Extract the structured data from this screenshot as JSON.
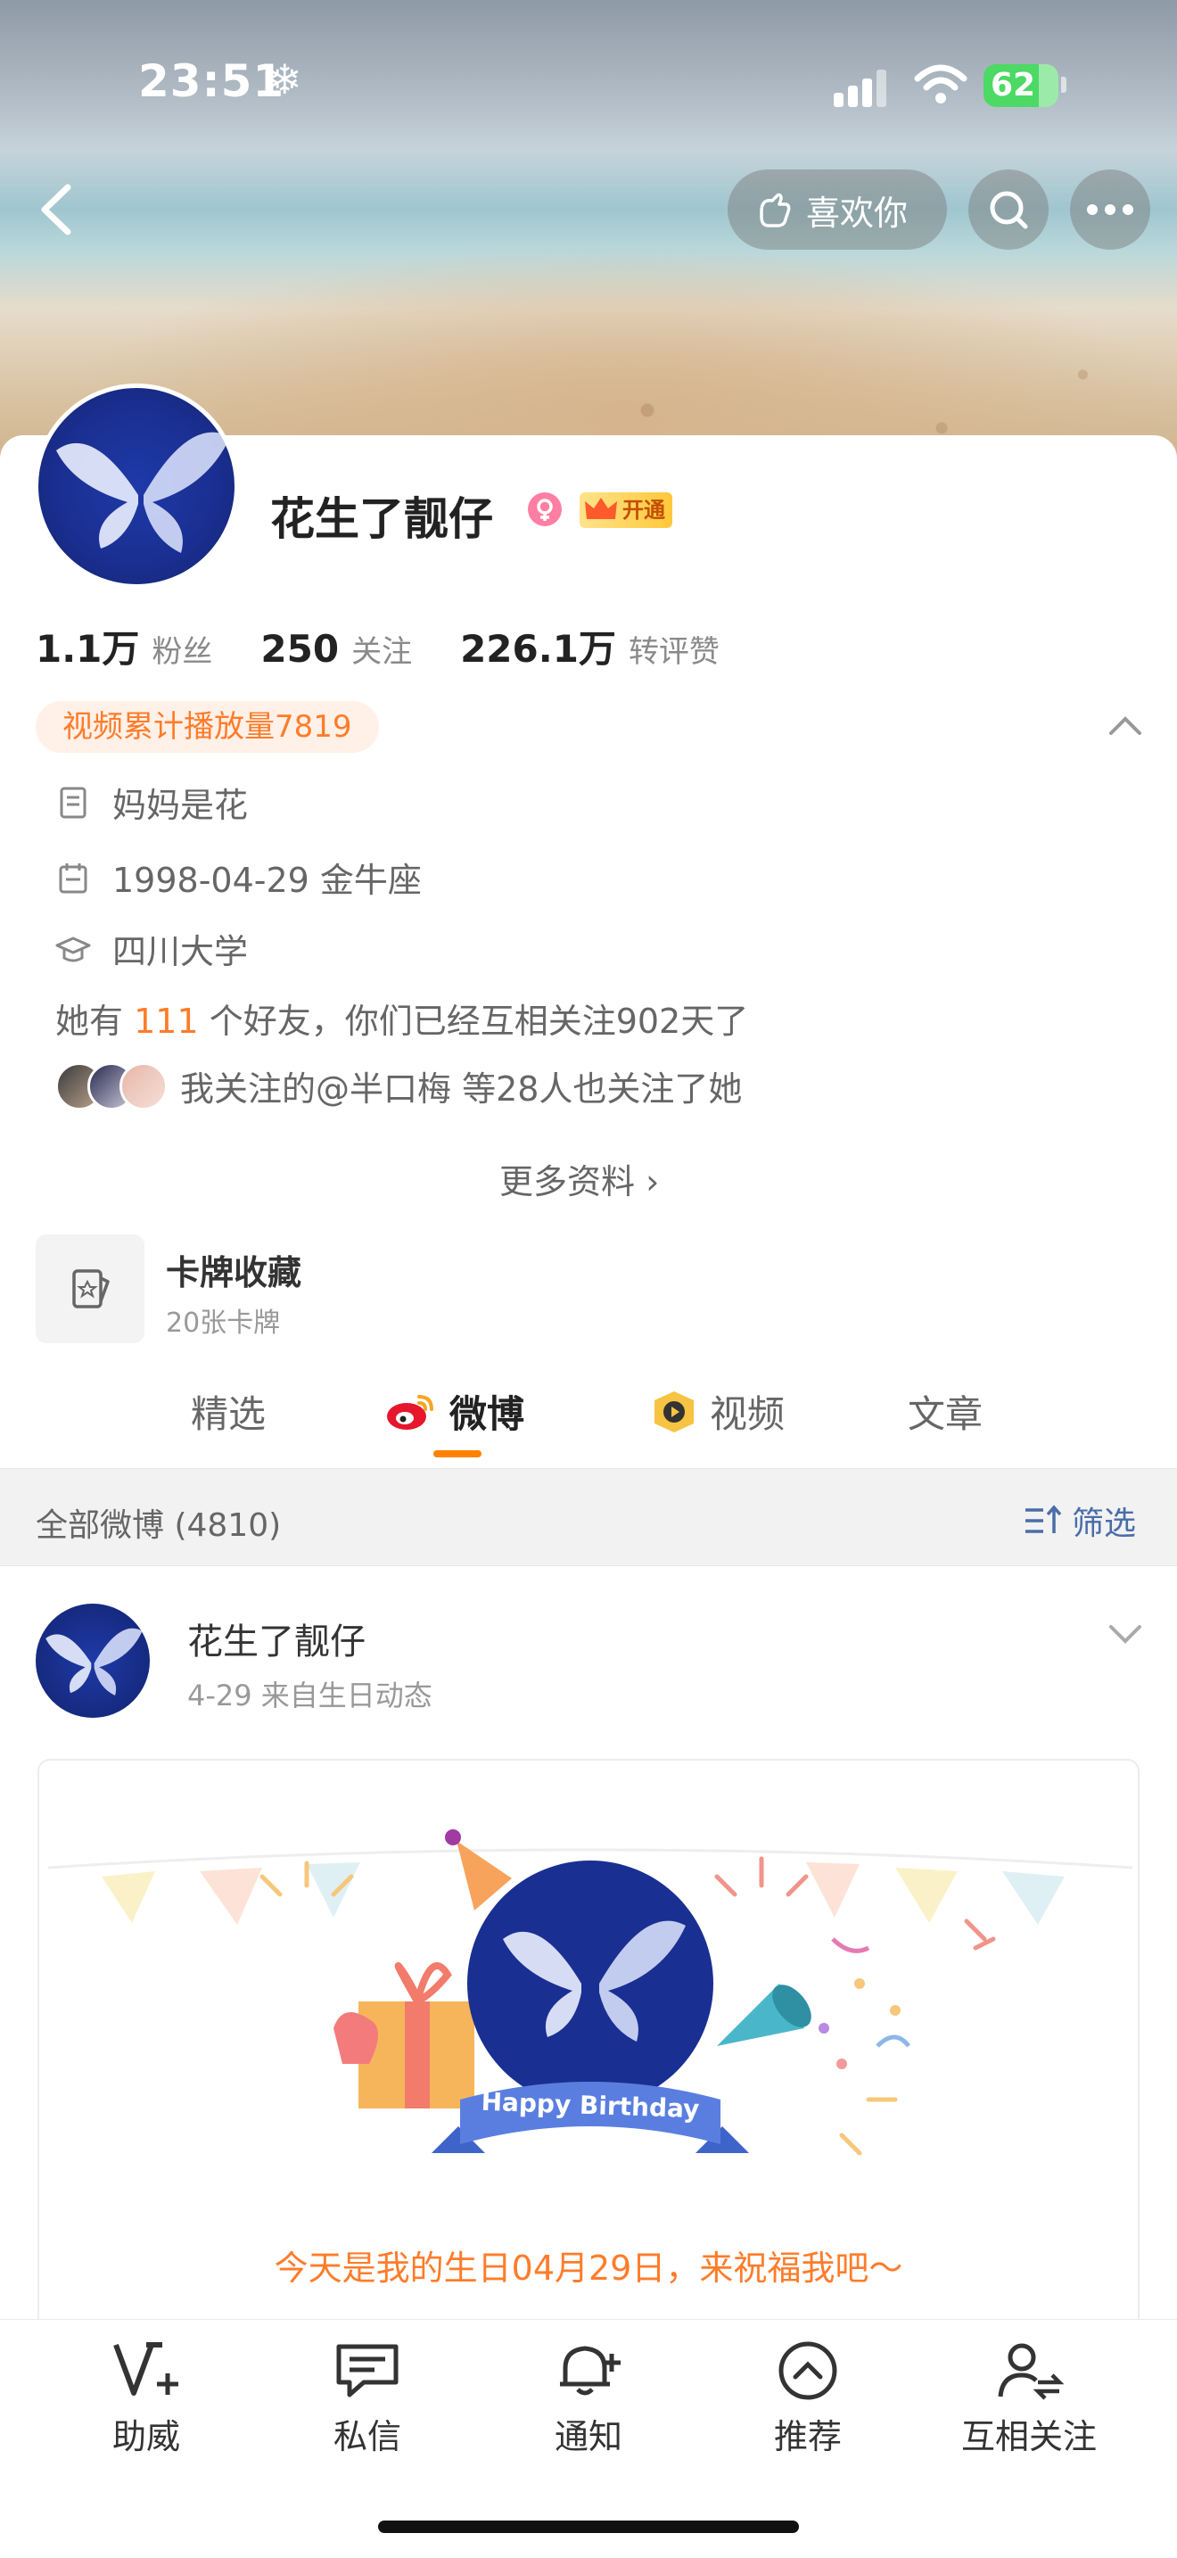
{
  "status_bar": {
    "time": "23:51",
    "battery": "62"
  },
  "header": {
    "like_label": "喜欢你"
  },
  "profile": {
    "nickname": "花生了靓仔",
    "vip_label": "开通",
    "stats": [
      {
        "value": "1.1万",
        "label": "粉丝"
      },
      {
        "value": "250",
        "label": "关注"
      },
      {
        "value": "226.1万",
        "label": "转评赞"
      }
    ],
    "video_tag": "视频累计播放量7819",
    "bio": "妈妈是花",
    "birthday": "1998-04-29 金牛座",
    "school": "四川大学",
    "friends": {
      "prefix": "她有 ",
      "count": "111",
      "suffix": " 个好友，你们已经互相关注902天了"
    },
    "mutual": "我关注的@半口梅 等28人也关注了她",
    "more_info": "更多资料 ›"
  },
  "cards": {
    "title": "卡牌收藏",
    "subtitle": "20张卡牌"
  },
  "tabs": [
    {
      "label": "精选"
    },
    {
      "label": "微博"
    },
    {
      "label": "视频"
    },
    {
      "label": "文章"
    }
  ],
  "filter": {
    "count_label": "全部微博 (4810)",
    "filter_label": "筛选"
  },
  "post": {
    "author": "花生了靓仔",
    "meta": "4-29  来自生日动态",
    "card_badge": "Happy Birthday",
    "card_text": "今天是我的生日04月29日，来祝福我吧～"
  },
  "bottom_nav": [
    {
      "label": "助威"
    },
    {
      "label": "私信"
    },
    {
      "label": "通知"
    },
    {
      "label": "推荐"
    },
    {
      "label": "互相关注"
    }
  ],
  "colors": {
    "accent": "#ff8200",
    "highlight": "#ff7c2a",
    "link_blue": "#4a6da7"
  }
}
